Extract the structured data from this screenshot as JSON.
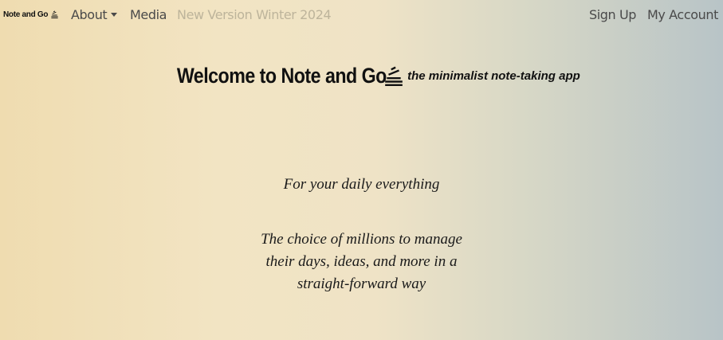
{
  "nav": {
    "brand": "Note and Go",
    "brand_icon": "stacked-notes-icon",
    "about": "About",
    "media": "Media",
    "new_version": "New Version Winter 2024",
    "sign_up": "Sign Up",
    "my_account": "My Account"
  },
  "hero": {
    "title": "Welcome to Note and Go",
    "title_icon": "stacked-notes-icon",
    "subtitle": "the minimalist note-taking app",
    "tagline": "For your daily everything",
    "description_lines": [
      "The choice of millions to manage",
      "their days, ideas, and more in a",
      "straight-forward way"
    ]
  },
  "colors": {
    "gradient_left": "#efdcb0",
    "gradient_right": "#b8c4c7",
    "nav_text": "#4a4a4a",
    "nav_muted": "#bdb49b"
  }
}
